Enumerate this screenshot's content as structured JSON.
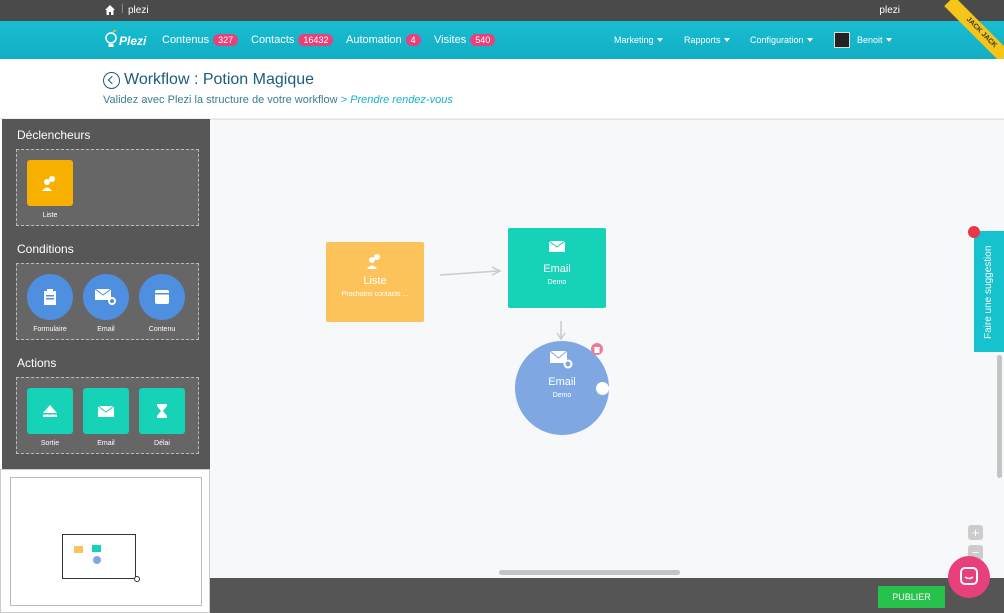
{
  "topbar": {
    "site": "plezi",
    "user": "plezi"
  },
  "nav": {
    "logo_text": "Plezi",
    "items": [
      {
        "label": "Contenus",
        "badge": "327"
      },
      {
        "label": "Contacts",
        "badge": "16432"
      },
      {
        "label": "Automation",
        "badge": "4"
      },
      {
        "label": "Visites",
        "badge": "540"
      }
    ],
    "right": [
      {
        "label": "Marketing"
      },
      {
        "label": "Rapports"
      },
      {
        "label": "Configuration"
      }
    ],
    "user_name": "Benoit",
    "ribbon": "JACK JACK"
  },
  "header": {
    "title": "Workflow : Potion Magique",
    "subtitle": "Validez avec Plezi la structure de votre workflow",
    "step": "> Prendre rendez-vous"
  },
  "sidebar": {
    "triggers_title": "Déclencheurs",
    "triggers": [
      {
        "label": "Liste"
      }
    ],
    "conditions_title": "Conditions",
    "conditions": [
      {
        "label": "Formulaire"
      },
      {
        "label": "Email"
      },
      {
        "label": "Contenu"
      }
    ],
    "actions_title": "Actions",
    "actions": [
      {
        "label": "Sortie"
      },
      {
        "label": "Email"
      },
      {
        "label": "Délai"
      }
    ]
  },
  "canvas": {
    "nodes": [
      {
        "title": "Liste",
        "sub": "Prochains contacts ...",
        "color": "#fbc35a"
      },
      {
        "title": "Email",
        "sub": "Demo",
        "color": "#16d3b8"
      },
      {
        "title": "Email",
        "sub": "Demo",
        "color": "#7fa8e2"
      }
    ]
  },
  "suggestion": "Faire une suggestion",
  "publish": "PUBLIER",
  "zoom": {
    "in": "+",
    "out": "−"
  },
  "colors": {
    "accent": "#14b3c9",
    "badge": "#e8407a",
    "publish": "#27c24c"
  }
}
